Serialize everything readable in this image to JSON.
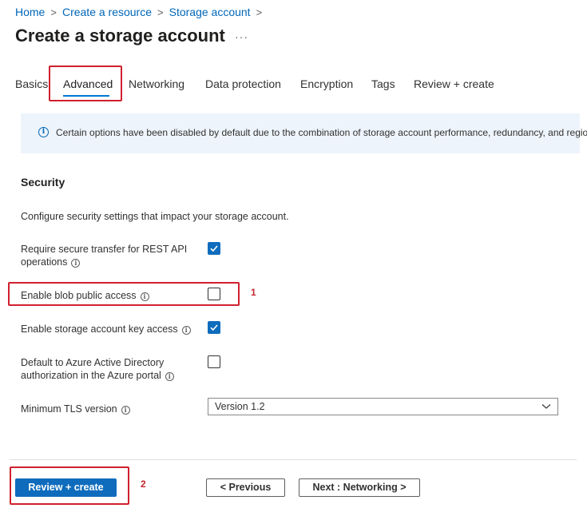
{
  "breadcrumb": {
    "items": [
      "Home",
      "Create a resource",
      "Storage account"
    ]
  },
  "page": {
    "title": "Create a storage account",
    "more": "···"
  },
  "tabs": [
    {
      "label": "Basics"
    },
    {
      "label": "Advanced",
      "active": true
    },
    {
      "label": "Networking"
    },
    {
      "label": "Data protection"
    },
    {
      "label": "Encryption"
    },
    {
      "label": "Tags"
    },
    {
      "label": "Review + create"
    }
  ],
  "info_banner": {
    "icon": "info-icon",
    "text": "Certain options have been disabled by default due to the combination of storage account performance, redundancy, and region."
  },
  "security": {
    "title": "Security",
    "description": "Configure security settings that impact your storage account.",
    "fields": [
      {
        "label_line1": "Require secure transfer for REST API",
        "label_line2": "operations",
        "checked": true
      },
      {
        "label_line1": "Enable blob public access",
        "checked": false
      },
      {
        "label_line1": "Enable storage account key access",
        "checked": true
      },
      {
        "label_line1": "Default to Azure Active Directory",
        "label_line2": "authorization in the Azure portal",
        "checked": false
      }
    ],
    "tls": {
      "label": "Minimum TLS version",
      "value": "Version 1.2"
    }
  },
  "annotations": {
    "marker1": "1",
    "marker2": "2"
  },
  "footer": {
    "review_create": "Review + create",
    "previous": "< Previous",
    "next": "Next : Networking >"
  },
  "colors": {
    "accent": "#0f6cbd",
    "link": "#0066b8",
    "annotation": "#d0202e",
    "banner_bg": "#eef4fb"
  }
}
